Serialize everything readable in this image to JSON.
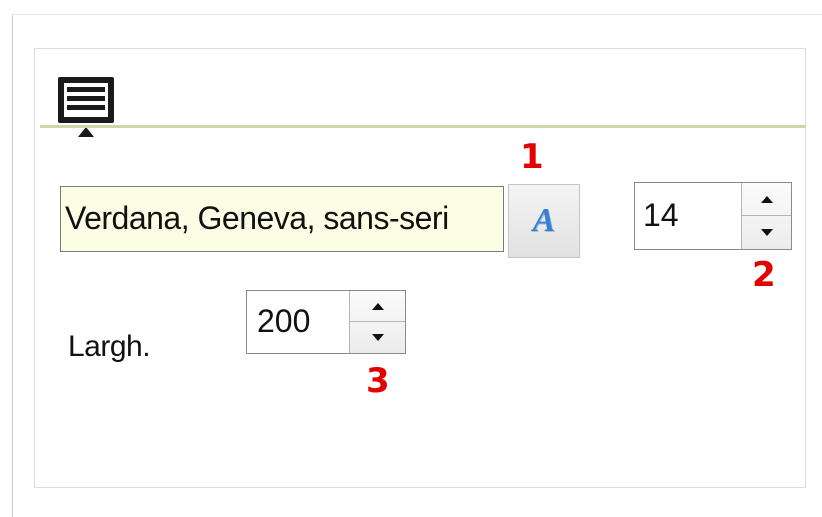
{
  "toolbar": {
    "panel_icon": "text-block-icon",
    "accent_line_color": "#c9d9a8"
  },
  "font": {
    "family_value": "Verdana, Geneva, sans-seri",
    "field_background": "#fbfde4",
    "picker_icon": "font-style-icon",
    "picker_glyph": "A",
    "size_value": "14"
  },
  "width": {
    "label": "Largh.",
    "value": "200"
  },
  "markers": {
    "color": "#e30000",
    "font_picker": "1",
    "font_size": "2",
    "width": "3"
  }
}
